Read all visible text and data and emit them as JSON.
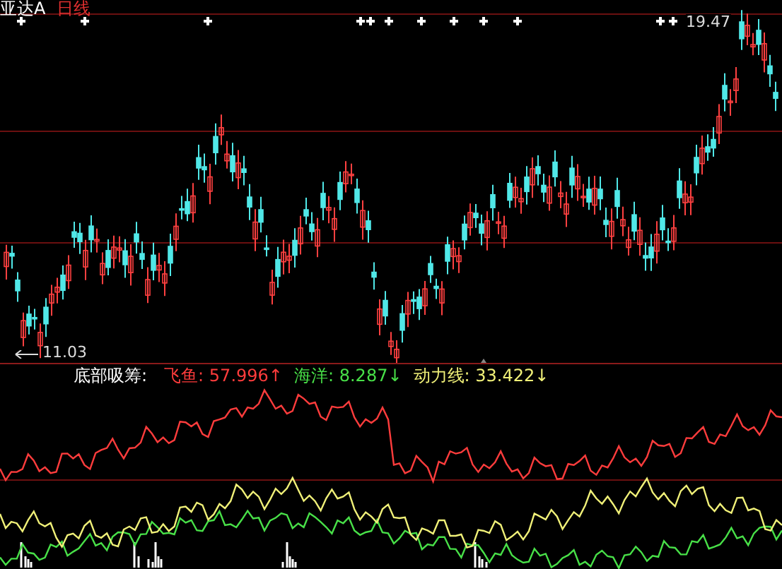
{
  "header": {
    "stock": "亚达A",
    "period": "日线"
  },
  "price_chart": {
    "high_label": "19.47",
    "low_label": "11.03"
  },
  "indicator": {
    "name": "底部吸筹:",
    "series": [
      {
        "label": "飞鱼:",
        "value": "57.996",
        "arrow": "↑",
        "color": "#ff3c3c"
      },
      {
        "label": "海洋:",
        "value": "8.287",
        "arrow": "↓",
        "color": "#48e048"
      },
      {
        "label": "动力线:",
        "value": "33.422",
        "arrow": "↓",
        "color": "#f0f078"
      }
    ]
  }
}
